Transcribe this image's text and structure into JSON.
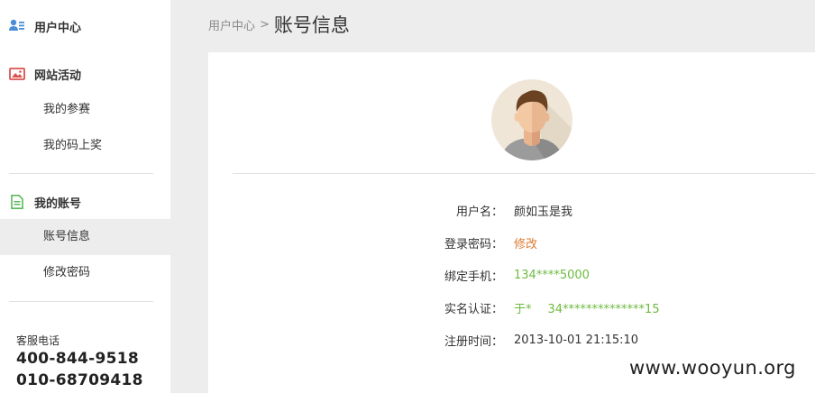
{
  "sidebar": {
    "user_center": {
      "label": "用户中心",
      "icon": "user-card-icon"
    },
    "activity": {
      "label": "网站活动",
      "icon": "image-icon",
      "items": [
        {
          "label": "我的参赛"
        },
        {
          "label": "我的码上奖"
        }
      ]
    },
    "account": {
      "label": "我的账号",
      "icon": "document-icon",
      "items": [
        {
          "label": "账号信息",
          "active": true
        },
        {
          "label": "修改密码"
        }
      ]
    },
    "service": {
      "label": "客服电话",
      "phones": [
        "400-844-9518",
        "010-68709418"
      ]
    }
  },
  "breadcrumb": {
    "root": "用户中心",
    "separator": ">",
    "current": "账号信息"
  },
  "profile": {
    "avatar_icon": "avatar-icon",
    "rows": [
      {
        "label": "用户名：",
        "value": "颜如玉是我"
      },
      {
        "label": "登录密码：",
        "value": "修改"
      },
      {
        "label": "绑定手机：",
        "value": "134****5000"
      },
      {
        "label": "实名认证：",
        "value_name": "于*",
        "value_id": "34**************15"
      },
      {
        "label": "注册时间：",
        "value": "2013-10-01 21:15:10"
      }
    ]
  },
  "watermark": "www.wooyun.org",
  "colors": {
    "accent_green": "#6dbb3f",
    "accent_orange": "#e07a32",
    "background": "#ededed"
  }
}
